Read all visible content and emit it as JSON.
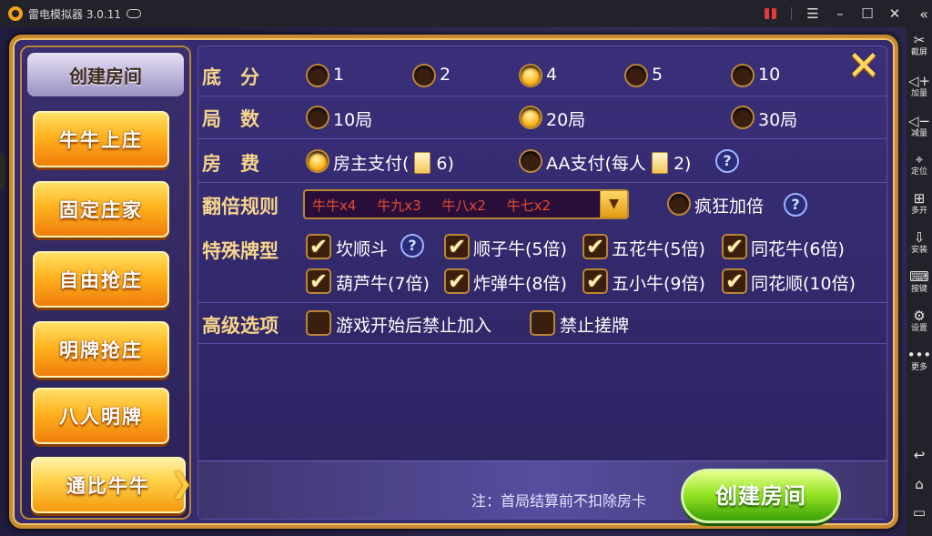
{
  "emulator": {
    "title": "雷电模拟器 3.0.11",
    "sidebar": [
      {
        "icon": "scissors-icon",
        "glyph": "✂",
        "label": "截屏"
      },
      {
        "icon": "volume-up-icon",
        "glyph": "◀",
        "label": "加量"
      },
      {
        "icon": "volume-down-icon",
        "glyph": "◀",
        "label": "减量"
      },
      {
        "icon": "location-icon",
        "glyph": "⌖",
        "label": "定位"
      },
      {
        "icon": "multi-open-icon",
        "glyph": "⊞",
        "label": "多开"
      },
      {
        "icon": "install-icon",
        "glyph": "⇩",
        "label": "安装"
      },
      {
        "icon": "keyboard-icon",
        "glyph": "⌨",
        "label": "按键"
      },
      {
        "icon": "settings-icon",
        "glyph": "⚙",
        "label": "设置"
      },
      {
        "icon": "more-icon",
        "glyph": "•••",
        "label": "更多"
      }
    ],
    "nav_glyphs": {
      "back": "↩",
      "home": "⌂",
      "recent": "▭"
    }
  },
  "left_panel": {
    "header": "创建房间",
    "modes": [
      "牛牛上庄",
      "固定庄家",
      "自由抢庄",
      "明牌抢庄",
      "八人明牌",
      "通比牛牛"
    ],
    "active_mode": "通比牛牛"
  },
  "form": {
    "base_score": {
      "label": "底　分",
      "options": [
        "1",
        "2",
        "4",
        "5",
        "10"
      ],
      "selected": "4"
    },
    "rounds": {
      "label": "局　数",
      "options": [
        "10局",
        "20局",
        "30局"
      ],
      "selected": "20局"
    },
    "room_fee": {
      "label": "房　费",
      "options": [
        {
          "text": "房主支付(",
          "cost": "6)"
        },
        {
          "text": "AA支付(每人",
          "cost": "2)"
        }
      ],
      "selected": "房主支付"
    },
    "double_rule": {
      "label": "翻倍规则",
      "values": [
        "牛牛x4",
        "牛九x3",
        "牛八x2",
        "牛七x2"
      ],
      "crazy_label": "疯狂加倍",
      "crazy_on": false
    },
    "special_cards": {
      "label": "特殊牌型",
      "items": [
        {
          "text": "坎顺斗",
          "checked": true
        },
        {
          "text": "顺子牛(5倍)",
          "checked": true
        },
        {
          "text": "五花牛(5倍)",
          "checked": true
        },
        {
          "text": "同花牛(6倍)",
          "checked": true
        },
        {
          "text": "葫芦牛(7倍)",
          "checked": true
        },
        {
          "text": "炸弹牛(8倍)",
          "checked": true
        },
        {
          "text": "五小牛(9倍)",
          "checked": true
        },
        {
          "text": "同花顺(10倍)",
          "checked": true
        }
      ]
    },
    "advanced": {
      "label": "高级选项",
      "items": [
        {
          "text": "游戏开始后禁止加入",
          "checked": false
        },
        {
          "text": "禁止搓牌",
          "checked": false
        }
      ]
    }
  },
  "footer": {
    "note": "注：首局结算前不扣除房卡",
    "create_button": "创建房间"
  },
  "colors": {
    "label": "#f6d48a",
    "accent_orange": "#ffb31e",
    "accent_green": "#8fe01f",
    "panel": "#352b6e"
  }
}
